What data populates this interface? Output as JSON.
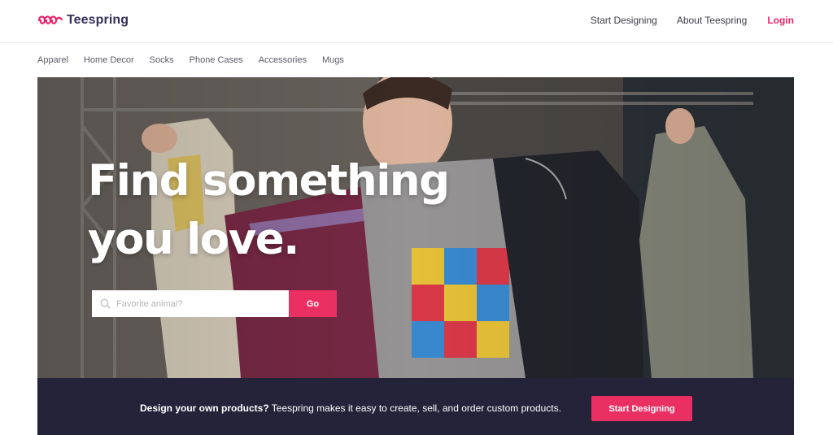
{
  "brand": {
    "name": "Teespring",
    "color": "#e8246b",
    "text_color": "#35305a"
  },
  "top_nav": {
    "start_designing": "Start Designing",
    "about": "About Teespring",
    "login": "Login"
  },
  "categories": [
    "Apparel",
    "Home Decor",
    "Socks",
    "Phone Cases",
    "Accessories",
    "Mugs"
  ],
  "hero": {
    "title_line1": "Find something",
    "title_line2": "you love.",
    "search_placeholder": "Favorite animal?",
    "search_value": "",
    "go_label": "Go",
    "search_icon": "search-icon"
  },
  "banner": {
    "bold_text": "Design your own products?",
    "text": " Teespring makes it easy to create, sell, and order custom products.",
    "button_label": "Start Designing",
    "background": "#25233a",
    "accent": "#ea2f63"
  }
}
